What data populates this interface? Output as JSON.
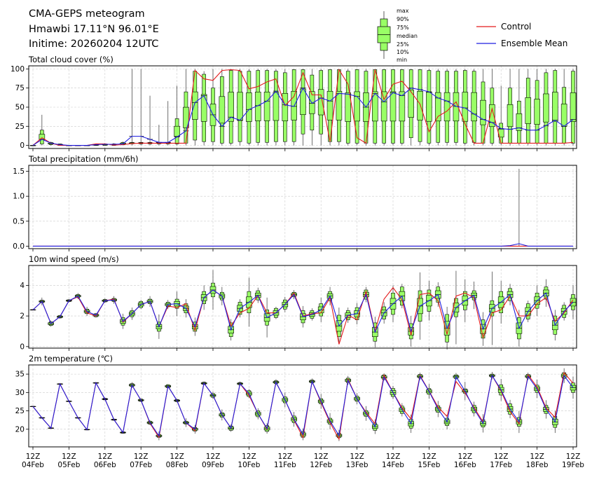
{
  "header": {
    "title": "CMA-GEPS meteogram",
    "location": "Hmawbi 17.11°N 96.01°E",
    "initime": "Initime: 20260204 12UTC"
  },
  "legend": {
    "box_labels": [
      "max",
      "90%",
      "75%",
      "median",
      "25%",
      "10%",
      "min"
    ],
    "control": "Control",
    "mean": "Ensemble Mean"
  },
  "colors": {
    "control": "#e41a1c",
    "mean": "#1f1fe0",
    "box": "#99ff66"
  },
  "chart_data": [
    {
      "type": "box+line",
      "title": "Total cloud cover (%)",
      "ylim": [
        -4,
        104
      ],
      "yticks": [
        0,
        25,
        50,
        75,
        100
      ],
      "mean": [
        0,
        8,
        3,
        1,
        0,
        0,
        0,
        1,
        1.5,
        1.5,
        2,
        12,
        12,
        8,
        4,
        4,
        11,
        19,
        56,
        65,
        40,
        25,
        37,
        33,
        47,
        52,
        58,
        71,
        53,
        51,
        75,
        55,
        62,
        58,
        68,
        67,
        64,
        50,
        68,
        57,
        69,
        65,
        75,
        73,
        70,
        62,
        58,
        51,
        49,
        41,
        34,
        30,
        22,
        21,
        23,
        20,
        20,
        26,
        33,
        25,
        34
      ],
      "control": [
        0,
        10,
        3,
        0,
        0,
        0,
        0,
        2,
        2,
        0.5,
        1,
        2.5,
        3,
        3,
        3,
        3,
        3,
        3,
        98,
        87,
        85,
        98,
        99,
        98,
        74,
        77,
        83,
        87,
        52,
        64,
        95,
        66,
        66,
        5,
        99,
        80,
        10,
        3,
        99,
        60,
        80,
        84,
        70,
        54,
        18,
        38,
        45,
        57,
        28,
        3,
        3,
        48,
        3,
        3,
        3,
        3,
        3,
        3,
        3,
        3,
        4
      ],
      "p10": [
        0,
        2,
        1,
        0,
        0,
        0,
        0,
        0,
        0,
        0,
        1,
        2,
        2,
        2,
        2,
        2,
        2,
        3,
        7,
        5,
        5,
        3,
        3,
        5,
        3,
        4,
        4,
        5,
        5,
        5,
        15,
        20,
        15,
        5,
        5,
        3,
        3,
        3,
        3,
        3,
        3,
        3,
        10,
        5,
        3,
        4,
        4,
        4,
        3,
        4,
        3,
        3,
        3,
        3,
        3,
        3,
        3,
        3,
        3,
        3,
        3
      ],
      "p90": [
        0,
        20,
        4,
        2,
        0,
        0,
        0,
        1,
        2,
        2,
        4,
        4,
        4,
        4,
        4,
        4,
        35,
        70,
        97,
        93,
        75,
        90,
        98,
        97,
        97,
        98,
        98,
        97,
        95,
        99,
        99,
        92,
        98,
        99,
        99,
        97,
        99,
        97,
        99,
        99,
        99,
        99,
        99,
        99,
        98,
        97,
        97,
        97,
        98,
        97,
        83,
        75,
        29,
        75,
        58,
        88,
        85,
        95,
        98,
        76,
        97
      ],
      "max": [
        0,
        40,
        5,
        2,
        0,
        0,
        0,
        2,
        3,
        3,
        5,
        100,
        100,
        65,
        27,
        58,
        78,
        100,
        100,
        97,
        100,
        100,
        100,
        100,
        100,
        100,
        100,
        100,
        100,
        100,
        100,
        100,
        100,
        100,
        100,
        100,
        100,
        100,
        100,
        100,
        100,
        100,
        100,
        100,
        100,
        100,
        100,
        100,
        100,
        100,
        100,
        100,
        78,
        100,
        100,
        100,
        100,
        100,
        100,
        100,
        100
      ]
    },
    {
      "type": "box+line",
      "title": "Total precipitation (mm/6h)",
      "ylim": [
        -0.05,
        1.62
      ],
      "yticks": [
        0.0,
        0.5,
        1.0,
        1.5
      ],
      "mean": [
        0,
        0,
        0,
        0,
        0,
        0,
        0,
        0,
        0,
        0,
        0,
        0,
        0,
        0,
        0,
        0,
        0,
        0,
        0,
        0,
        0,
        0,
        0,
        0,
        0,
        0,
        0,
        0,
        0,
        0,
        0,
        0,
        0,
        0,
        0,
        0,
        0,
        0,
        0,
        0,
        0,
        0,
        0,
        0,
        0,
        0,
        0,
        0,
        0,
        0,
        0,
        0,
        0,
        0.01,
        0.05,
        0,
        0,
        0,
        0,
        0,
        0
      ],
      "control": [
        0,
        0,
        0,
        0,
        0,
        0,
        0,
        0,
        0,
        0,
        0,
        0,
        0,
        0,
        0,
        0,
        0,
        0,
        0,
        0,
        0,
        0,
        0,
        0,
        0,
        0,
        0,
        0,
        0,
        0,
        0,
        0,
        0,
        0,
        0,
        0,
        0,
        0,
        0,
        0,
        0,
        0,
        0,
        0,
        0,
        0,
        0,
        0,
        0,
        0,
        0,
        0,
        0,
        0,
        0,
        0,
        0,
        0,
        0,
        0,
        0
      ],
      "spike_index": 54,
      "spike_max": 1.55
    },
    {
      "type": "box+line",
      "title": "10m wind speed (m/s)",
      "ylim": [
        -0.1,
        5.3
      ],
      "yticks": [
        0,
        2,
        4
      ],
      "mean": [
        2.4,
        2.95,
        1.5,
        1.95,
        3.0,
        3.3,
        2.3,
        2.05,
        3.0,
        3.05,
        1.65,
        2.15,
        2.75,
        2.95,
        1.3,
        2.75,
        2.8,
        2.5,
        1.3,
        3.2,
        3.7,
        3.3,
        1.1,
        2.5,
        2.9,
        3.35,
        1.9,
        2.2,
        2.75,
        3.4,
        1.95,
        2.1,
        2.4,
        3.3,
        1.35,
        2.05,
        2.15,
        3.4,
        0.95,
        2.2,
        2.8,
        3.3,
        1.0,
        2.65,
        3.0,
        3.4,
        1.2,
        2.55,
        3.0,
        3.35,
        1.15,
        2.5,
        2.9,
        3.4,
        1.2,
        2.3,
        3.0,
        3.5,
        1.4,
        2.3,
        2.9
      ],
      "control": [
        2.4,
        2.95,
        1.5,
        1.95,
        3.0,
        3.25,
        2.2,
        2.0,
        3.0,
        3.1,
        1.6,
        2.15,
        2.75,
        2.95,
        1.3,
        2.65,
        2.55,
        2.8,
        1.05,
        3.2,
        3.7,
        3.3,
        1.35,
        2.2,
        2.5,
        3.35,
        2.2,
        2.2,
        2.75,
        3.5,
        2.0,
        2.15,
        2.2,
        3.2,
        0.15,
        2.05,
        1.75,
        3.6,
        1.0,
        3.1,
        3.85,
        3.05,
        0.75,
        3.4,
        3.5,
        3.0,
        0.8,
        3.3,
        3.5,
        3.2,
        0.6,
        2.2,
        2.4,
        3.3,
        2.0,
        2.0,
        2.8,
        3.2,
        1.65,
        2.2,
        3.05
      ],
      "box_half": [
        0.02,
        0.08,
        0.12,
        0.08,
        0.06,
        0.1,
        0.15,
        0.1,
        0.08,
        0.1,
        0.25,
        0.2,
        0.2,
        0.15,
        0.3,
        0.15,
        0.3,
        0.3,
        0.3,
        0.4,
        0.45,
        0.25,
        0.45,
        0.4,
        0.7,
        0.3,
        0.5,
        0.3,
        0.3,
        0.15,
        0.4,
        0.25,
        0.4,
        0.3,
        0.7,
        0.3,
        0.4,
        0.3,
        0.6,
        0.4,
        0.7,
        0.6,
        0.5,
        1.0,
        0.7,
        0.5,
        0.9,
        0.6,
        0.6,
        0.3,
        0.6,
        0.5,
        0.7,
        0.4,
        0.7,
        0.5,
        0.5,
        0.4,
        0.6,
        0.4,
        0.5
      ],
      "whisker_half": [
        0.02,
        0.25,
        0.2,
        0.12,
        0.1,
        0.2,
        0.3,
        0.15,
        0.15,
        0.25,
        0.5,
        0.4,
        0.3,
        0.35,
        0.8,
        0.3,
        0.8,
        0.6,
        0.6,
        0.8,
        1.3,
        0.6,
        0.7,
        0.6,
        1.6,
        0.5,
        1.3,
        0.4,
        0.5,
        0.3,
        0.7,
        0.4,
        0.8,
        0.6,
        1.2,
        0.5,
        0.7,
        0.5,
        1.0,
        0.7,
        1.2,
        0.8,
        1.0,
        2.2,
        1.3,
        0.8,
        1.4,
        2.4,
        1.4,
        0.9,
        1.1,
        2.4,
        1.4,
        0.7,
        1.2,
        0.7,
        1.0,
        0.9,
        1.0,
        0.6,
        1.1
      ]
    },
    {
      "type": "box+line",
      "title": "2m temperature (℃)",
      "ylim": [
        15.2,
        37.5
      ],
      "yticks": [
        20,
        25,
        30,
        35
      ],
      "mean": [
        26.2,
        23.1,
        20.3,
        32.3,
        27.6,
        23.1,
        19.9,
        32.6,
        28.2,
        22.6,
        19.1,
        32.0,
        27.9,
        21.8,
        18.2,
        31.7,
        27.8,
        21.8,
        20.0,
        32.5,
        29.2,
        23.9,
        20.3,
        32.4,
        29.7,
        24.2,
        20.2,
        32.8,
        28.0,
        22.7,
        18.6,
        33.0,
        27.6,
        22.2,
        18.3,
        33.3,
        28.3,
        24.3,
        20.7,
        34.2,
        30.0,
        25.3,
        21.5,
        34.4,
        30.3,
        25.5,
        22.0,
        34.3,
        30.4,
        25.5,
        21.6,
        34.6,
        30.7,
        25.5,
        22.0,
        34.4,
        31.0,
        25.4,
        22.0,
        34.6,
        31.3
      ],
      "control": [
        26.2,
        23.1,
        20.3,
        32.3,
        27.6,
        23.1,
        19.9,
        32.6,
        28.2,
        22.6,
        19.1,
        32.0,
        27.9,
        21.6,
        17.8,
        31.7,
        27.8,
        21.8,
        19.6,
        32.5,
        29.2,
        23.9,
        20.3,
        32.4,
        29.2,
        24.2,
        20.0,
        32.8,
        28.0,
        22.5,
        17.8,
        33.0,
        27.3,
        21.8,
        17.3,
        33.6,
        28.3,
        24.6,
        21.5,
        34.7,
        30.0,
        25.8,
        22.8,
        34.6,
        30.4,
        26.0,
        23.5,
        33.0,
        29.9,
        25.9,
        22.0,
        34.6,
        30.4,
        24.8,
        21.5,
        34.8,
        31.5,
        25.8,
        23.2,
        35.4,
        32.5
      ],
      "box_half": [
        0.05,
        0.1,
        0.1,
        0.1,
        0.1,
        0.1,
        0.1,
        0.1,
        0.2,
        0.15,
        0.2,
        0.4,
        0.3,
        0.4,
        0.4,
        0.4,
        0.3,
        0.4,
        0.5,
        0.3,
        0.5,
        0.6,
        0.6,
        0.3,
        0.8,
        0.8,
        0.8,
        0.4,
        0.8,
        0.9,
        0.8,
        0.4,
        0.7,
        0.8,
        0.6,
        0.6,
        0.7,
        0.8,
        1.0,
        0.6,
        1.1,
        1.0,
        1.2,
        0.5,
        0.8,
        0.9,
        1.0,
        0.5,
        0.6,
        1.0,
        1.0,
        0.4,
        1.4,
        1.4,
        1.2,
        0.5,
        1.0,
        1.1,
        1.5,
        0.8,
        1.3
      ],
      "whisker_half": [
        0.1,
        0.2,
        0.2,
        0.2,
        0.2,
        0.2,
        0.2,
        0.2,
        0.3,
        0.3,
        0.3,
        0.8,
        0.5,
        0.7,
        1.2,
        0.6,
        0.5,
        1.2,
        1.2,
        0.5,
        1.0,
        1.5,
        1.0,
        0.6,
        1.2,
        1.5,
        1.4,
        0.8,
        2.0,
        2.0,
        1.6,
        0.8,
        2.0,
        2.2,
        1.5,
        1.2,
        1.5,
        2.0,
        2.0,
        1.0,
        1.8,
        1.8,
        2.5,
        1.0,
        2.0,
        2.2,
        2.0,
        1.0,
        2.5,
        2.0,
        2.5,
        1.0,
        3.0,
        2.5,
        3.0,
        1.0,
        2.5,
        2.5,
        3.0,
        2.0,
        3.0
      ]
    }
  ],
  "xaxis": {
    "hour_label": "12Z",
    "dates": [
      "04Feb",
      "05Feb",
      "06Feb",
      "07Feb",
      "08Feb",
      "09Feb",
      "10Feb",
      "11Feb",
      "12Feb",
      "13Feb",
      "14Feb",
      "15Feb",
      "16Feb",
      "17Feb",
      "18Feb",
      "19Feb"
    ]
  }
}
